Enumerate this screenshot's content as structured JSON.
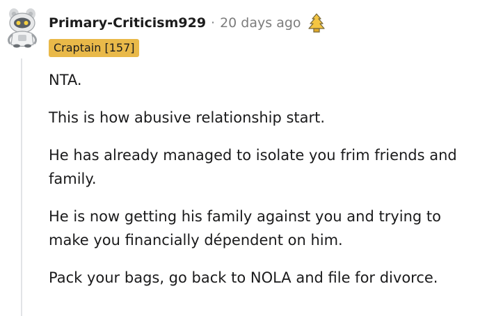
{
  "comment": {
    "username": "Primary-Criticism929",
    "separator": "·",
    "timestamp": "20 days ago",
    "award_icon": "helpful-award-icon",
    "flair": "Craptain [157]",
    "paragraphs": [
      "NTA.",
      "This is how abusive relationship start.",
      "He has already managed to isolate you frim friends and family.",
      "He is now getting his family against you and trying to make you financially dépendent on him.",
      "Pack your bags, go back to NOLA and file for divorce."
    ]
  },
  "colors": {
    "flair_background": "#e9b949",
    "username": "#1c1c1c",
    "timestamp": "#7c7c7c",
    "thread_line": "#e2e4e6"
  }
}
